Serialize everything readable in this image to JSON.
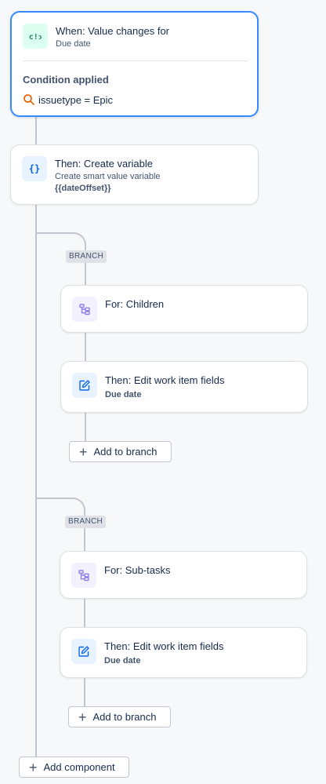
{
  "trigger": {
    "title": "When: Value changes for",
    "subtitle": "Due date",
    "condition_heading": "Condition applied",
    "condition_text": "issuetype = Epic",
    "icon": "value-change-icon"
  },
  "action_create_variable": {
    "title": "Then: Create variable",
    "subtitle": "Create smart value variable",
    "variable": "{{dateOffset}}",
    "icon": "braces-icon"
  },
  "branches": [
    {
      "tag": "BRANCH",
      "for_title": "For: Children",
      "action_title": "Then: Edit work item fields",
      "action_subtitle": "Due date",
      "add_label": "Add to branch"
    },
    {
      "tag": "BRANCH",
      "for_title": "For: Sub-tasks",
      "action_title": "Then: Edit work item fields",
      "action_subtitle": "Due date",
      "add_label": "Add to branch"
    }
  ],
  "add_component_label": "Add component",
  "colors": {
    "accent_border": "#388bff",
    "trigger_icon_bg": "#dcfff1",
    "trigger_icon_fg": "#1f845a",
    "action_icon_bg": "#e9f2ff",
    "action_icon_fg": "#0c66e4",
    "branch_icon_bg": "#f3f0ff",
    "branch_icon_fg": "#8f7ee7",
    "search_icon": "#e56910"
  }
}
